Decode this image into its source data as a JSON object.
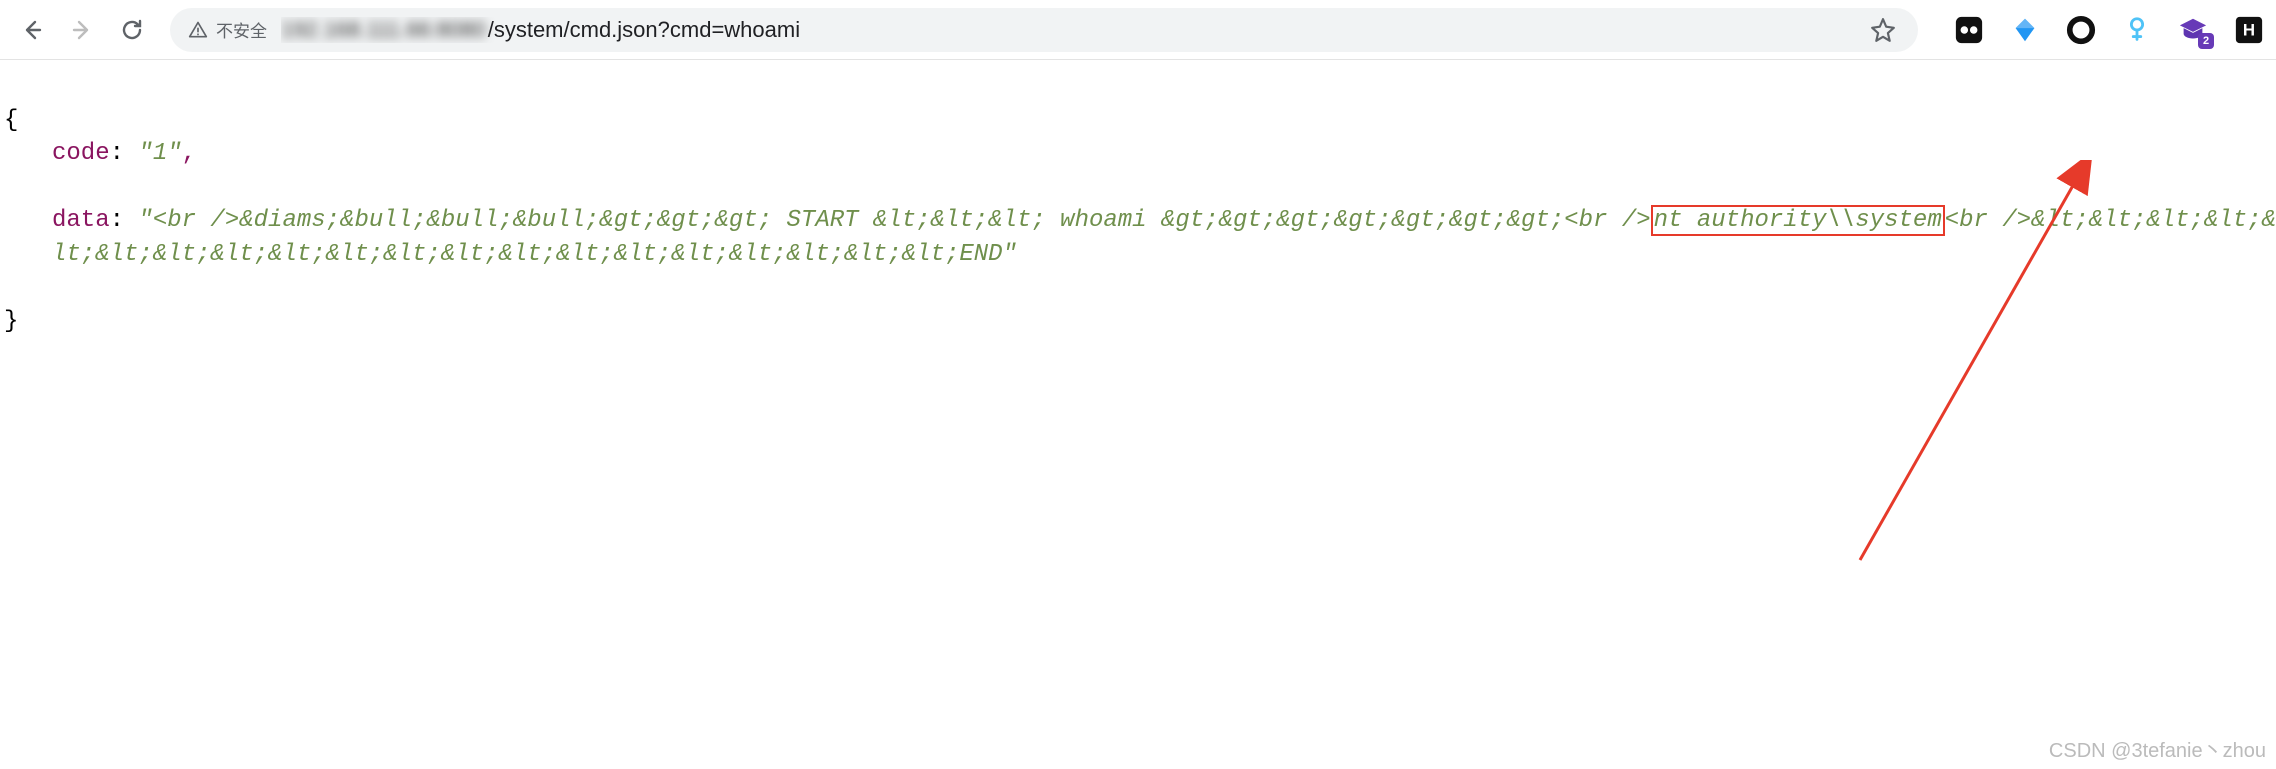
{
  "browser": {
    "security_label": "不安全",
    "url_host_blurred": "192.168.111.66:8080",
    "url_visible": "/system/cmd.json?cmd=whoami"
  },
  "ext_badge": "2",
  "response": {
    "open": "{",
    "close": "}",
    "code_key": "code",
    "code_val": "\"1\"",
    "comma": ",",
    "data_key": "data",
    "data_pre": "\"<br />&diams;&bull;&bull;&bull;&gt;&gt;&gt; START &lt;&lt;&lt; whoami &gt;&gt;&gt;&gt;&gt;&gt;&gt;<br />",
    "data_hit": "nt authority\\\\system",
    "data_post": "<br />&lt;&lt;&lt;&lt;&lt;&lt;&lt;&lt;&lt;&lt;&lt;&lt;&lt;&lt;&lt;&lt;&lt;&lt;&lt;&lt;END\""
  },
  "watermark": "CSDN @3tefanie丶zhou"
}
